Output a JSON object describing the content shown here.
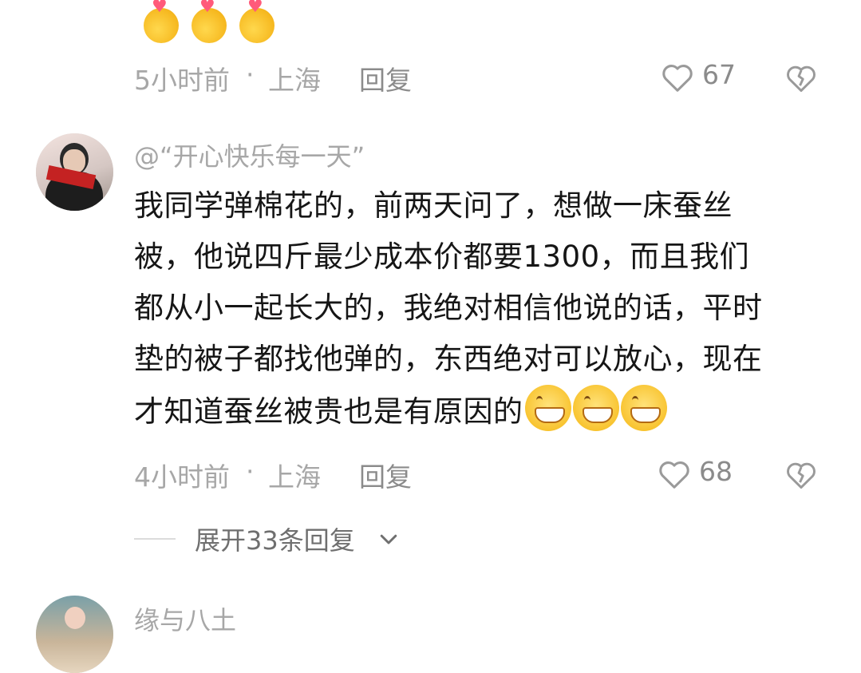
{
  "comment1": {
    "time": "5小时前",
    "location": "上海",
    "reply_label": "回复",
    "likes": "67"
  },
  "comment2": {
    "mention": "@“开心快乐每一天”",
    "text_lines": [
      "我同学弹棉花的，前两天问了，想做一床蚕丝",
      "被，他说四斤最少成本价都要1300，而且我们",
      "都从小一起长大的，我绝对相信他说的话，平时",
      "垫的被子都找他弹的，东西绝对可以放心，现在",
      "才知道蚕丝被贵也是有原因的"
    ],
    "time": "4小时前",
    "location": "上海",
    "reply_label": "回复",
    "likes": "68",
    "expand_label": "展开33条回复"
  },
  "comment3": {
    "username": "缘与八土"
  },
  "icons": {
    "like": "heart-outline-icon",
    "dislike": "broken-heart-icon",
    "expand": "chevron-down-icon",
    "emoji_top": "heart-hands-emoji",
    "emoji_text": "grinning-emoji"
  },
  "colors": {
    "text": "#161616",
    "meta": "#a7a7a7",
    "secondary": "#8b8b8b"
  }
}
